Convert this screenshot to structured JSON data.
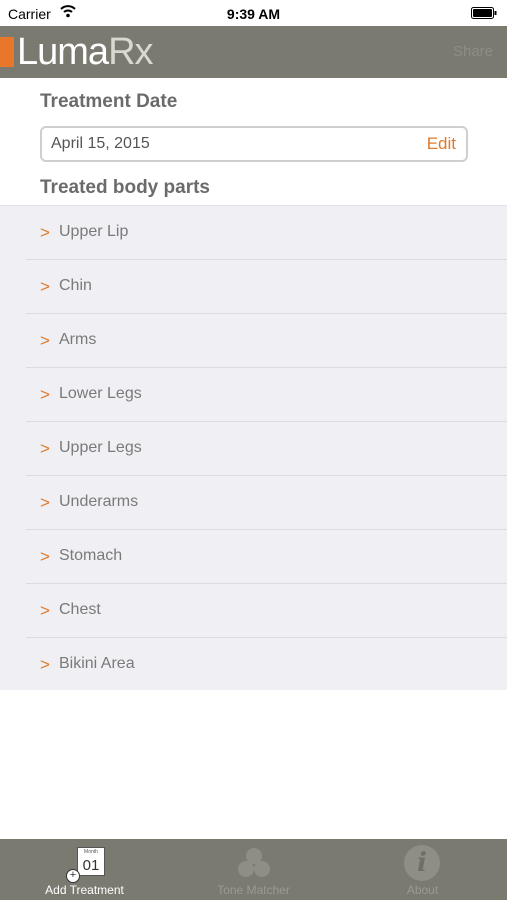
{
  "status_bar": {
    "carrier": "Carrier",
    "time": "9:39 AM",
    "icons": [
      "wifi-icon",
      "battery-icon"
    ]
  },
  "nav_bar": {
    "logo_main": "Luma",
    "logo_accent": "Rx",
    "right_button": "Share"
  },
  "treatment_date": {
    "title": "Treatment Date",
    "value": "April 15, 2015",
    "edit_label": "Edit"
  },
  "body_parts": {
    "title": "Treated body parts",
    "chevron": ">",
    "items": [
      "Upper Lip",
      "Chin",
      "Arms",
      "Lower Legs",
      "Upper Legs",
      "Underarms",
      "Stomach",
      "Chest",
      "Bikini Area"
    ]
  },
  "tab_bar": {
    "tabs": [
      {
        "label": "Add Treatment",
        "icon": "calendar-add-icon",
        "active": true
      },
      {
        "label": "Tone Matcher",
        "icon": "tone-circles-icon",
        "active": false
      },
      {
        "label": "About",
        "icon": "info-icon",
        "active": false
      }
    ],
    "calendar_month": "Month",
    "calendar_day": "01"
  },
  "colors": {
    "accent": "#e07a2a",
    "bar": "#7a7a70",
    "list_bg": "#efeff4"
  }
}
